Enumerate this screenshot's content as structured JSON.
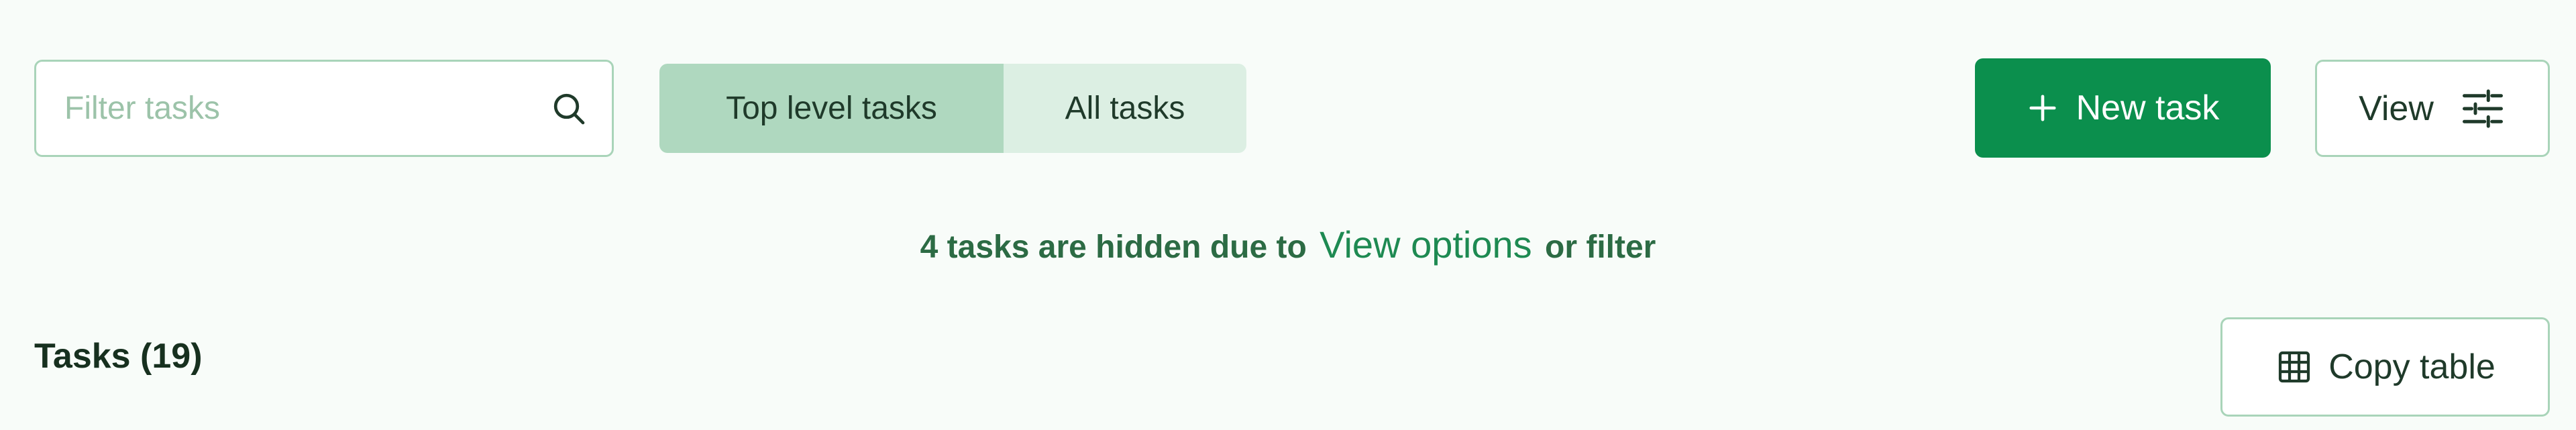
{
  "filter": {
    "placeholder": "Filter tasks",
    "value": "",
    "icon": "search-icon"
  },
  "tabs": [
    {
      "label": "Top level tasks",
      "selected": true
    },
    {
      "label": "All tasks",
      "selected": false
    }
  ],
  "toolbar": {
    "new_task_label": "New task",
    "new_task_icon": "plus-icon",
    "view_label": "View",
    "view_icon": "sliders-icon"
  },
  "notice": {
    "prefix": "4 tasks are hidden due to",
    "link": "View options",
    "suffix": "or filter"
  },
  "tasks": {
    "heading": "Tasks (19)",
    "copy_label": "Copy table",
    "copy_icon": "table-icon"
  },
  "colors": {
    "background": "#f8fcf9",
    "primary": "#0b8f4d",
    "border": "#a9d4b9",
    "tab_active": "#afd8bf",
    "tab_inactive": "#dcefe3",
    "link": "#1e8a52"
  }
}
